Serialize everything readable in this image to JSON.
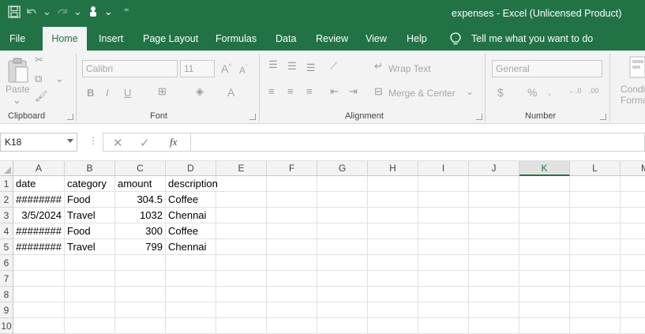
{
  "window": {
    "title": "expenses  -  Excel (Unlicensed Product)"
  },
  "menu": {
    "tabs": [
      "File",
      "Home",
      "Insert",
      "Page Layout",
      "Formulas",
      "Data",
      "Review",
      "View",
      "Help"
    ],
    "active": "Home",
    "tell_me": "Tell me what you want to do"
  },
  "ribbon": {
    "clipboard": {
      "label": "Clipboard",
      "paste": "Paste"
    },
    "font": {
      "label": "Font",
      "name": "Calibri",
      "size": "11",
      "bold": "B",
      "italic": "I",
      "underline": "U"
    },
    "alignment": {
      "label": "Alignment",
      "wrap": "Wrap Text",
      "merge": "Merge & Center"
    },
    "number": {
      "label": "Number",
      "format": "General",
      "currency": "$",
      "percent": "%",
      "comma": ","
    },
    "styles": {
      "label": "Conditional Formatting"
    }
  },
  "formula_bar": {
    "name_box": "K18",
    "fx": "fx",
    "formula": ""
  },
  "sheet": {
    "columns": [
      "A",
      "B",
      "C",
      "D",
      "E",
      "F",
      "G",
      "H",
      "I",
      "J",
      "K",
      "L",
      "M"
    ],
    "selected_column": "K",
    "rows": [
      "1",
      "2",
      "3",
      "4",
      "5",
      "6",
      "7",
      "8",
      "9",
      "10"
    ],
    "data": [
      [
        "date",
        "category",
        "amount",
        "description"
      ],
      [
        "########",
        "Food",
        "304.5",
        "Coffee"
      ],
      [
        "3/5/2024",
        "Travel",
        "1032",
        "Chennai"
      ],
      [
        "########",
        "Food",
        "300",
        "Coffee"
      ],
      [
        "########",
        "Travel",
        "799",
        "Chennai"
      ]
    ]
  },
  "colors": {
    "accent": "#217346",
    "ribbon_bg": "#f3f3f3"
  }
}
